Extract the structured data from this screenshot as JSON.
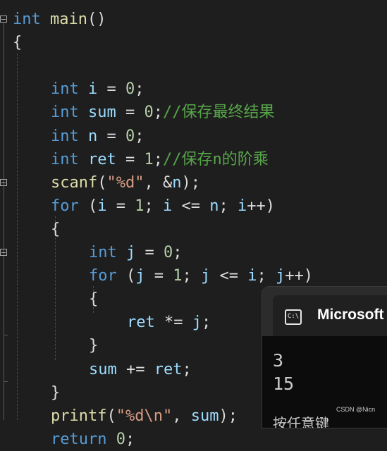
{
  "editor": {
    "lines": [
      {
        "indent": 0,
        "tokens": [
          {
            "t": "int",
            "c": "kw"
          },
          {
            "t": " ",
            "c": "pn"
          },
          {
            "t": "main",
            "c": "fn"
          },
          {
            "t": "()",
            "c": "pn"
          }
        ]
      },
      {
        "indent": 0,
        "tokens": [
          {
            "t": "{",
            "c": "pn"
          }
        ]
      },
      {
        "indent": 0,
        "tokens": []
      },
      {
        "indent": 1,
        "tokens": [
          {
            "t": "int",
            "c": "kw"
          },
          {
            "t": " ",
            "c": "pn"
          },
          {
            "t": "i",
            "c": "id"
          },
          {
            "t": " = ",
            "c": "pn"
          },
          {
            "t": "0",
            "c": "num"
          },
          {
            "t": ";",
            "c": "pn"
          }
        ]
      },
      {
        "indent": 1,
        "tokens": [
          {
            "t": "int",
            "c": "kw"
          },
          {
            "t": " ",
            "c": "pn"
          },
          {
            "t": "sum",
            "c": "id"
          },
          {
            "t": " = ",
            "c": "pn"
          },
          {
            "t": "0",
            "c": "num"
          },
          {
            "t": ";",
            "c": "pn"
          },
          {
            "t": "//保存最终结果",
            "c": "cm"
          }
        ]
      },
      {
        "indent": 1,
        "tokens": [
          {
            "t": "int",
            "c": "kw"
          },
          {
            "t": " ",
            "c": "pn"
          },
          {
            "t": "n",
            "c": "id"
          },
          {
            "t": " = ",
            "c": "pn"
          },
          {
            "t": "0",
            "c": "num"
          },
          {
            "t": ";",
            "c": "pn"
          }
        ]
      },
      {
        "indent": 1,
        "tokens": [
          {
            "t": "int",
            "c": "kw"
          },
          {
            "t": " ",
            "c": "pn"
          },
          {
            "t": "ret",
            "c": "id"
          },
          {
            "t": " = ",
            "c": "pn"
          },
          {
            "t": "1",
            "c": "num"
          },
          {
            "t": ";",
            "c": "pn"
          },
          {
            "t": "//保存n的阶乘",
            "c": "cm"
          }
        ]
      },
      {
        "indent": 1,
        "tokens": [
          {
            "t": "scanf",
            "c": "fn"
          },
          {
            "t": "(",
            "c": "pn"
          },
          {
            "t": "\"%d\"",
            "c": "str"
          },
          {
            "t": ", &",
            "c": "pn"
          },
          {
            "t": "n",
            "c": "id"
          },
          {
            "t": ");",
            "c": "pn"
          }
        ]
      },
      {
        "indent": 1,
        "tokens": [
          {
            "t": "for",
            "c": "kw"
          },
          {
            "t": " (",
            "c": "pn"
          },
          {
            "t": "i",
            "c": "id"
          },
          {
            "t": " = ",
            "c": "pn"
          },
          {
            "t": "1",
            "c": "num"
          },
          {
            "t": "; ",
            "c": "pn"
          },
          {
            "t": "i",
            "c": "id"
          },
          {
            "t": " <= ",
            "c": "pn"
          },
          {
            "t": "n",
            "c": "id"
          },
          {
            "t": "; ",
            "c": "pn"
          },
          {
            "t": "i",
            "c": "id"
          },
          {
            "t": "++)",
            "c": "pn"
          }
        ]
      },
      {
        "indent": 1,
        "tokens": [
          {
            "t": "{",
            "c": "pn"
          }
        ]
      },
      {
        "indent": 2,
        "tokens": [
          {
            "t": "int",
            "c": "kw"
          },
          {
            "t": " ",
            "c": "pn"
          },
          {
            "t": "j",
            "c": "id"
          },
          {
            "t": " = ",
            "c": "pn"
          },
          {
            "t": "0",
            "c": "num"
          },
          {
            "t": ";",
            "c": "pn"
          }
        ]
      },
      {
        "indent": 2,
        "tokens": [
          {
            "t": "for",
            "c": "kw"
          },
          {
            "t": " (",
            "c": "pn"
          },
          {
            "t": "j",
            "c": "id"
          },
          {
            "t": " = ",
            "c": "pn"
          },
          {
            "t": "1",
            "c": "num"
          },
          {
            "t": "; ",
            "c": "pn"
          },
          {
            "t": "j",
            "c": "id"
          },
          {
            "t": " <= ",
            "c": "pn"
          },
          {
            "t": "i",
            "c": "id"
          },
          {
            "t": "; ",
            "c": "pn"
          },
          {
            "t": "j",
            "c": "id"
          },
          {
            "t": "++)",
            "c": "pn"
          }
        ]
      },
      {
        "indent": 2,
        "tokens": [
          {
            "t": "{",
            "c": "pn"
          }
        ]
      },
      {
        "indent": 3,
        "tokens": [
          {
            "t": "ret",
            "c": "id"
          },
          {
            "t": " *= ",
            "c": "pn"
          },
          {
            "t": "j",
            "c": "id"
          },
          {
            "t": ";",
            "c": "pn"
          }
        ]
      },
      {
        "indent": 2,
        "tokens": [
          {
            "t": "}",
            "c": "pn"
          }
        ]
      },
      {
        "indent": 2,
        "tokens": [
          {
            "t": "sum",
            "c": "id"
          },
          {
            "t": " += ",
            "c": "pn"
          },
          {
            "t": "ret",
            "c": "id"
          },
          {
            "t": ";",
            "c": "pn"
          }
        ]
      },
      {
        "indent": 1,
        "tokens": [
          {
            "t": "}",
            "c": "pn"
          }
        ]
      },
      {
        "indent": 1,
        "tokens": [
          {
            "t": "printf",
            "c": "fn"
          },
          {
            "t": "(",
            "c": "pn"
          },
          {
            "t": "\"%d\\n\"",
            "c": "str"
          },
          {
            "t": ", ",
            "c": "pn"
          },
          {
            "t": "sum",
            "c": "id"
          },
          {
            "t": ");",
            "c": "pn"
          }
        ]
      },
      {
        "indent": 1,
        "tokens": [
          {
            "t": "return",
            "c": "kw"
          },
          {
            "t": " ",
            "c": "pn"
          },
          {
            "t": "0",
            "c": "num"
          },
          {
            "t": ";",
            "c": "pn"
          }
        ]
      }
    ]
  },
  "console": {
    "icon_glyph": "C:\\",
    "title": "Microsoft",
    "output": [
      "3",
      "15"
    ],
    "cut_off_text": "按任意键"
  },
  "watermark": "CSDN @Nicn",
  "colors": {
    "background": "#1e1e1e",
    "keyword": "#569cd6",
    "identifier": "#9cdcfe",
    "function": "#dcdcaa",
    "number": "#b5cea8",
    "string": "#d69d85",
    "comment": "#57a64a"
  }
}
